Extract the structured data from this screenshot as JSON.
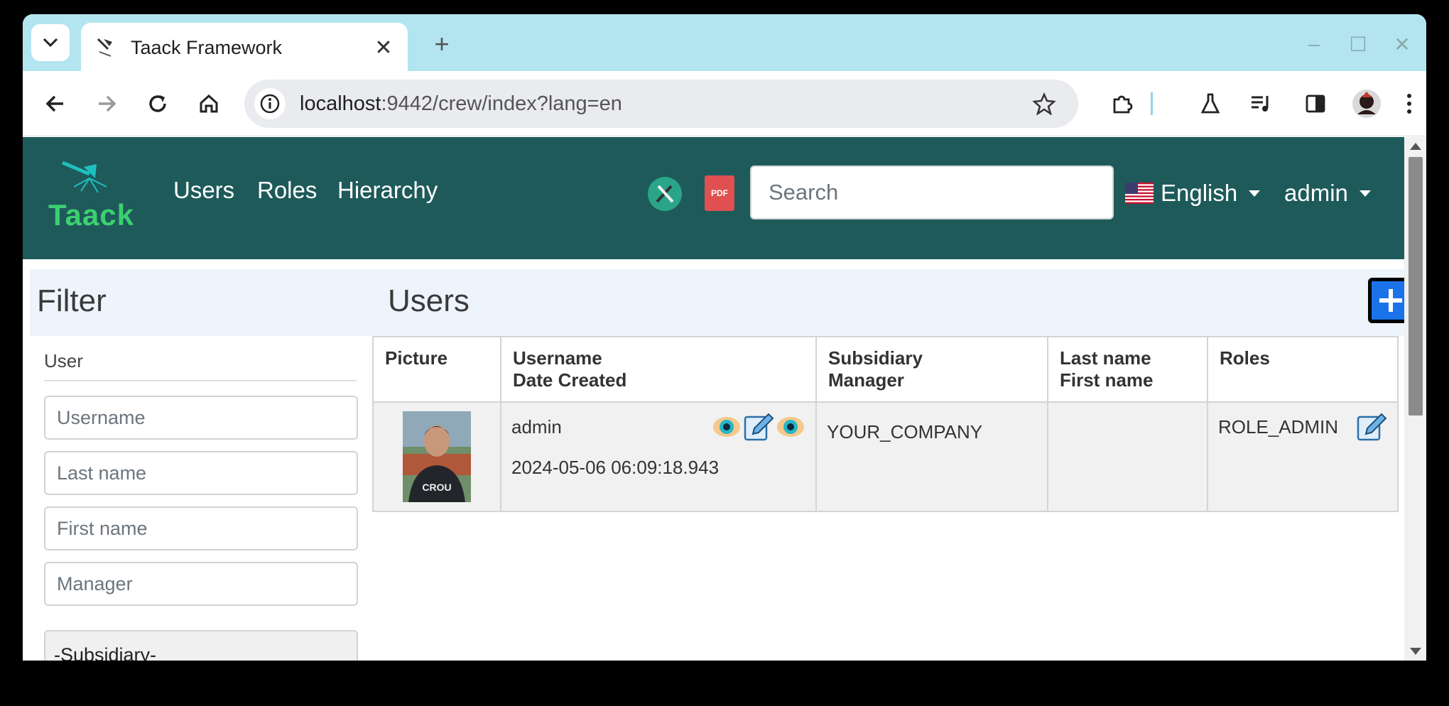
{
  "browser": {
    "tab_title": "Taack Framework",
    "url_host": "localhost",
    "url_rest": ":9442/crew/index?lang=en"
  },
  "navbar": {
    "logo_text": "Taack",
    "links": [
      "Users",
      "Roles",
      "Hierarchy"
    ],
    "search_placeholder": "Search",
    "language": "English",
    "user": "admin"
  },
  "filter": {
    "title": "Filter",
    "section_label": "User",
    "inputs": [
      "Username",
      "Last name",
      "First name",
      "Manager"
    ],
    "subsidiary_select": "-Subsidiary-"
  },
  "users": {
    "title": "Users",
    "columns": [
      [
        "Picture"
      ],
      [
        "Username",
        "Date Created"
      ],
      [
        "Subsidiary",
        "Manager"
      ],
      [
        "Last name",
        "First name"
      ],
      [
        "Roles"
      ]
    ],
    "rows": [
      {
        "username": "admin",
        "date_created": "2024-05-06 06:09:18.943",
        "subsidiary": "YOUR_COMPANY",
        "last_first": "",
        "roles": "ROLE_ADMIN"
      }
    ]
  },
  "colors": {
    "navbar": "#1e5a5a",
    "tabstrip": "#b3e5f0",
    "accent": "#1a73e8"
  }
}
